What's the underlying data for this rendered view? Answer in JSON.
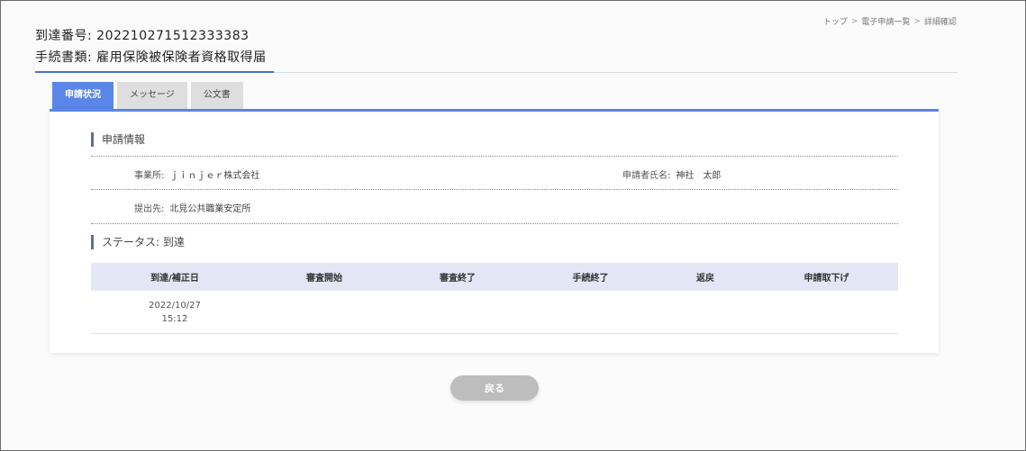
{
  "breadcrumb": {
    "items": [
      "トップ",
      "電子申請一覧",
      "詳細確認"
    ],
    "separator": ">"
  },
  "header": {
    "arrival_label": "到達番号: ",
    "arrival_number": "202210271512333383",
    "procedure_label": "手続書類: ",
    "procedure_name": "雇用保険被保険者資格取得届"
  },
  "tabs": [
    {
      "label": "申請状況",
      "active": true
    },
    {
      "label": "メッセージ",
      "active": false
    },
    {
      "label": "公文書",
      "active": false
    }
  ],
  "application_info": {
    "title": "申請情報",
    "office_label": "事業所:",
    "office_value": "ｊｉｎｊｅｒ株式会社",
    "applicant_label": "申請者氏名:",
    "applicant_value": "神社　太郎",
    "submit_to_label": "提出先:",
    "submit_to_value": "北見公共職業安定所"
  },
  "status": {
    "title": "ステータス: 到達",
    "columns": [
      "到達/補正日",
      "審査開始",
      "審査終了",
      "手続終了",
      "返戻",
      "申請取下げ"
    ],
    "rows": [
      {
        "arrival_date": "2022/10/27",
        "arrival_time": "15:12",
        "review_start": "",
        "review_end": "",
        "procedure_end": "",
        "returned": "",
        "withdrawn": ""
      }
    ]
  },
  "back_button": {
    "label": "戻る"
  },
  "colors": {
    "accent": "#5a86e8",
    "tab_inactive": "#dedede",
    "table_head": "#e3e7f5",
    "back_button": "#bdbdbd"
  }
}
